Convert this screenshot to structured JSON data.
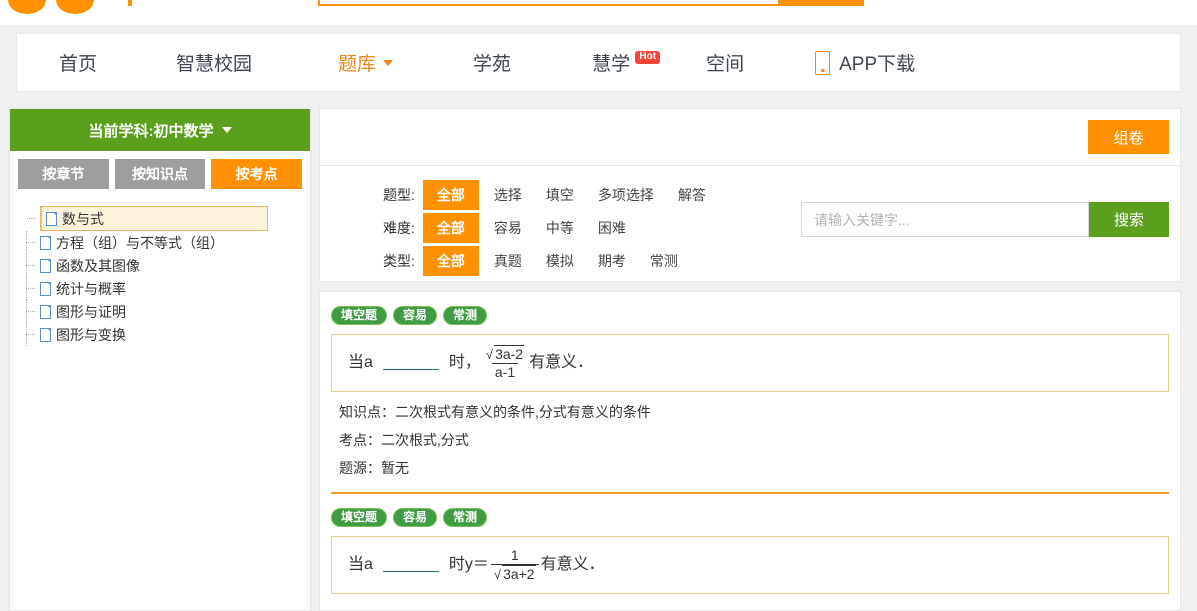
{
  "top_strip": {
    "logo": "logo-dots",
    "search_button": "search-submit"
  },
  "nav": {
    "items": [
      {
        "label": "首页",
        "name": "nav-home",
        "active": false,
        "caret": false,
        "badge": null,
        "icon": null
      },
      {
        "label": "智慧校园",
        "name": "nav-smart-campus",
        "active": false,
        "caret": false,
        "badge": null,
        "icon": null
      },
      {
        "label": "题库",
        "name": "nav-question-bank",
        "active": true,
        "caret": true,
        "badge": null,
        "icon": null
      },
      {
        "label": "学苑",
        "name": "nav-academy",
        "active": false,
        "caret": false,
        "badge": null,
        "icon": null
      },
      {
        "label": "慧学",
        "name": "nav-huixue",
        "active": false,
        "caret": false,
        "badge": "Hot",
        "icon": null
      },
      {
        "label": "空间",
        "name": "nav-space",
        "active": false,
        "caret": false,
        "badge": null,
        "icon": null
      },
      {
        "label": "APP下载",
        "name": "nav-app-download",
        "active": false,
        "caret": false,
        "badge": null,
        "icon": "phone-icon"
      }
    ]
  },
  "sidebar": {
    "subject_label": "当前学科:初中数学",
    "tabs": [
      {
        "label": "按章节",
        "active": false
      },
      {
        "label": "按知识点",
        "active": false
      },
      {
        "label": "按考点",
        "active": true
      }
    ],
    "tree": [
      {
        "label": "数与式",
        "selected": true
      },
      {
        "label": "方程（组）与不等式（组）",
        "selected": false
      },
      {
        "label": "函数及其图像",
        "selected": false
      },
      {
        "label": "统计与概率",
        "selected": false
      },
      {
        "label": "图形与证明",
        "selected": false
      },
      {
        "label": "图形与变换",
        "selected": false
      }
    ]
  },
  "toolbar": {
    "compose_label": "组卷"
  },
  "filters": {
    "rows": [
      {
        "label": "题型:",
        "options": [
          {
            "label": "全部",
            "active": true
          },
          {
            "label": "选择",
            "active": false
          },
          {
            "label": "填空",
            "active": false
          },
          {
            "label": "多项选择",
            "active": false
          },
          {
            "label": "解答",
            "active": false
          }
        ]
      },
      {
        "label": "难度:",
        "options": [
          {
            "label": "全部",
            "active": true
          },
          {
            "label": "容易",
            "active": false
          },
          {
            "label": "中等",
            "active": false
          },
          {
            "label": "困难",
            "active": false
          }
        ]
      },
      {
        "label": "类型:",
        "options": [
          {
            "label": "全部",
            "active": true
          },
          {
            "label": "真题",
            "active": false
          },
          {
            "label": "模拟",
            "active": false
          },
          {
            "label": "期考",
            "active": false
          },
          {
            "label": "常测",
            "active": false
          }
        ]
      }
    ]
  },
  "search": {
    "value": "",
    "placeholder": "请输入关键字...",
    "button_label": "搜索"
  },
  "questions": [
    {
      "tags": [
        "填空题",
        "容易",
        "常测"
      ],
      "prefix": "当a",
      "middle": "时，",
      "formula": {
        "numerator_radical": "3a-2",
        "denominator": "a-1",
        "kind": "radical-over-linear"
      },
      "suffix": "有意义．",
      "meta": [
        "知识点：二次根式有意义的条件,分式有意义的条件",
        "考点：二次根式,分式",
        "题源：暂无"
      ]
    },
    {
      "tags": [
        "填空题",
        "容易",
        "常测"
      ],
      "prefix": "当a",
      "middle": "时y＝",
      "formula": {
        "numerator": "1",
        "denominator_radical": "3a+2",
        "kind": "one-over-radical"
      },
      "suffix": "有意义．",
      "meta": []
    }
  ],
  "colors": {
    "orange": "#ff9000",
    "green": "#5ba01d",
    "tag_green": "#3f9c43",
    "hot_red": "#f5443a",
    "page_bg": "#f0f0f0"
  }
}
